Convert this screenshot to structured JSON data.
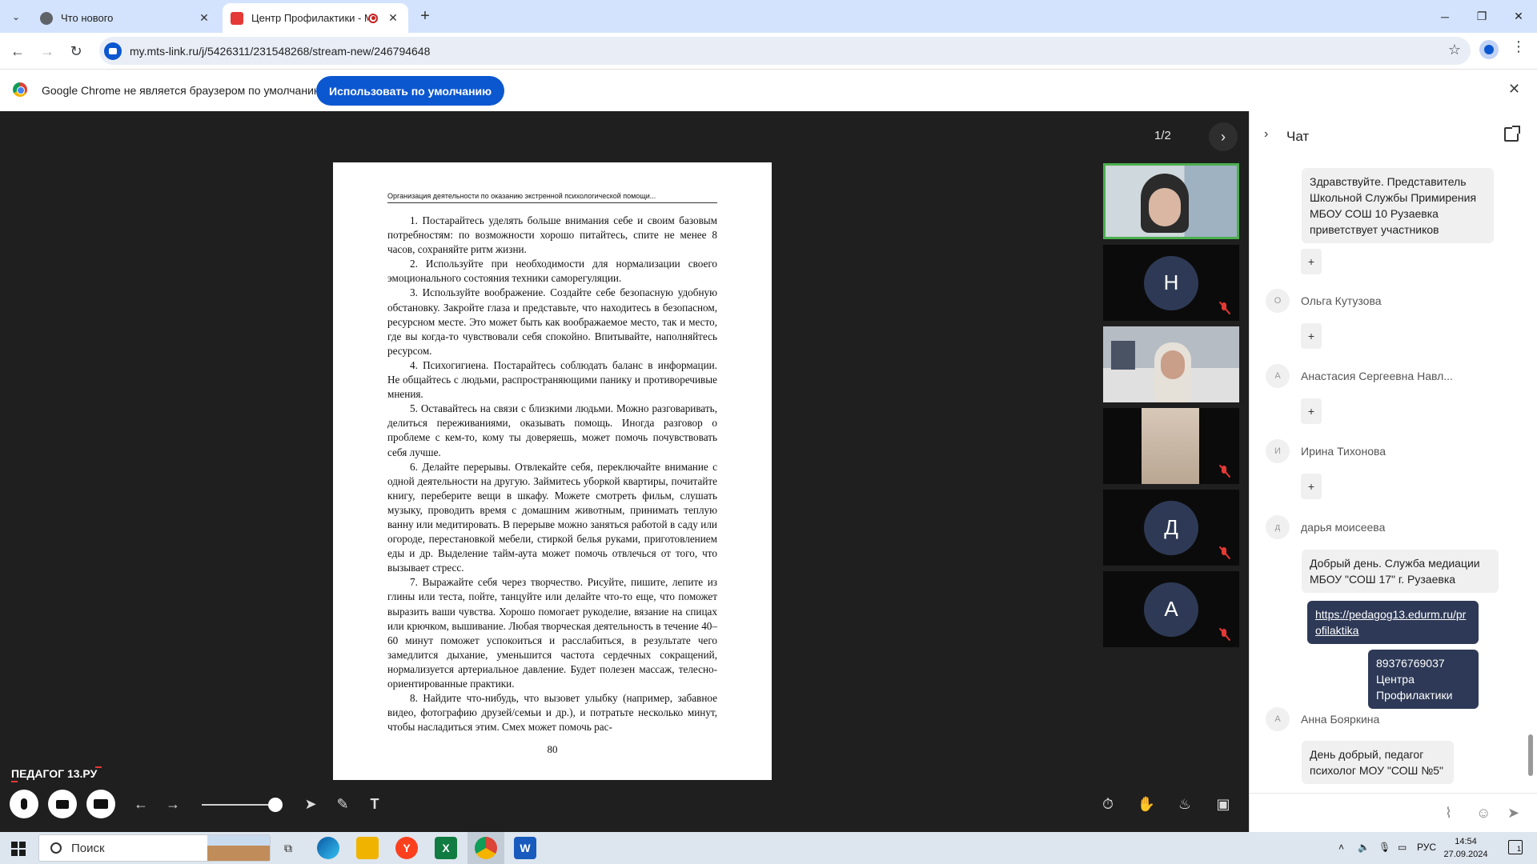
{
  "browser": {
    "tabs": [
      {
        "title": "Что нового",
        "active": false
      },
      {
        "title": "Центр Профилактики - MT",
        "active": true
      }
    ],
    "url": "my.mts-link.ru/j/5426311/231548268/stream-new/246794648",
    "infobar": {
      "message": "Google Chrome не является браузером по умолчанию.",
      "button": "Использовать по умолчанию"
    },
    "colors": {
      "tabstrip": "#d3e3fd",
      "accent": "#0b57d0"
    }
  },
  "stage": {
    "page_counter": "1/2",
    "brand": "ПЕДАГОГ 13.РУ",
    "document": {
      "header": "Организация деятельности по оказанию экстренной психологической помощи...",
      "paragraphs": [
        "1. Постарайтесь уделять больше внимания себе и своим базовым потребностям: по возможности хорошо питайтесь, спите не менее 8 часов, сохраняйте ритм жизни.",
        "2. Используйте при необходимости для нормализации своего эмоционального состояния техники саморегуляции.",
        "3. Используйте воображение. Создайте себе безопасную удобную обстановку. Закройте глаза и представьте, что находитесь в безопасном, ресурсном месте. Это может быть как воображаемое место, так и место, где вы когда-то чувствовали себя спокойно. Впитывайте, наполняйтесь ресурсом.",
        "4. Психогигиена. Постарайтесь соблюдать баланс в информации. Не общайтесь с людьми, распространяющими панику и противоречивые мнения.",
        "5. Оставайтесь на связи с близкими людьми. Можно разговаривать, делиться переживаниями, оказывать помощь. Иногда разговор о проблеме с кем-то, кому ты доверяешь, может помочь почувствовать себя лучше.",
        "6. Делайте перерывы. Отвлекайте себя, переключайте внимание с одной деятельности на другую. Займитесь уборкой квартиры, почитайте книгу, переберите вещи в шкафу. Можете смотреть фильм, слушать музыку, проводить время с домашним животным, принимать теплую ванну или медитировать. В перерыве можно заняться работой в саду или огороде, перестановкой мебели, стиркой белья руками, приготовлением еды и др. Выделение тайм-аута может помочь отвлечься от того, что вызывает стресс.",
        "7. Выражайте себя через творчество. Рисуйте, пишите, лепите из глины или теста, пойте, танцуйте или делайте что-то еще, что поможет выразить ваши чувства. Хорошо помогает рукоделие, вязание на спицах или крючком, вышивание. Любая творческая деятельность в течение 40–60 минут поможет успокоиться и расслабиться, в результате чего замедлится дыхание, уменьшится частота сердечных сокращений, нормализуется артериальное давление. Будет полезен массаж, телесно-ориентированные практики.",
        "8. Найдите что-нибудь, что вызовет улыбку (например, забавное видео, фотографию друзей/семьи и др.), и потратьте несколько минут, чтобы насладиться этим. Смех может помочь рас-"
      ],
      "page_number": "80"
    },
    "participants": [
      {
        "type": "video",
        "active": true,
        "muted": false
      },
      {
        "type": "avatar",
        "initial": "Н",
        "muted": true
      },
      {
        "type": "video",
        "active": false,
        "muted": false
      },
      {
        "type": "video",
        "active": false,
        "muted": true
      },
      {
        "type": "avatar",
        "initial": "Д",
        "muted": true
      },
      {
        "type": "avatar",
        "initial": "А",
        "muted": true
      }
    ]
  },
  "chat": {
    "title": "Чат",
    "messages": [
      {
        "kind": "bubble",
        "text": "Здравствуйте. Представитель Школьной Службы Примирения МБОУ СОШ 10 Рузаевка приветствует участников"
      },
      {
        "kind": "plus",
        "text": "+"
      },
      {
        "kind": "author",
        "initial": "О",
        "name": "Ольга Кутузова"
      },
      {
        "kind": "plus",
        "text": "+"
      },
      {
        "kind": "author",
        "initial": "А",
        "name": "Анастасия Сергеевна Навл..."
      },
      {
        "kind": "plus",
        "text": "+"
      },
      {
        "kind": "author",
        "initial": "И",
        "name": "Ирина Тихонова"
      },
      {
        "kind": "plus",
        "text": "+"
      },
      {
        "kind": "author",
        "initial": "д",
        "name": "дарья моисеева"
      },
      {
        "kind": "bubble",
        "text": "Добрый день. Служба медиации МБОУ \"СОШ 17\" г. Рузаевка"
      },
      {
        "kind": "own-link",
        "text": "https://pedagog13.edurm.ru/profilaktika"
      },
      {
        "kind": "own",
        "text": "89376769037 Центра Профилактики"
      },
      {
        "kind": "author",
        "initial": "А",
        "name": "Анна Бояркина"
      },
      {
        "kind": "bubble",
        "text": "День добрый,    педагог психолог МОУ \"СОШ №5\""
      }
    ]
  },
  "taskbar": {
    "search_placeholder": "Поиск",
    "language": "РУС",
    "time": "14:54",
    "date": "27.09.2024",
    "notifications": "1"
  }
}
